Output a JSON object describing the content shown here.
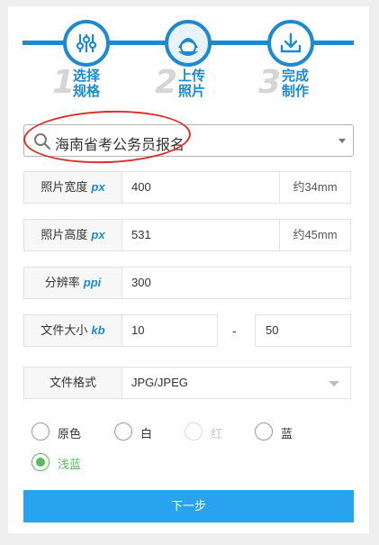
{
  "steps": [
    {
      "num": "1",
      "line1": "选择",
      "line2": "规格",
      "icon": "sliders-icon"
    },
    {
      "num": "2",
      "line1": "上传",
      "line2": "照片",
      "icon": "person-icon"
    },
    {
      "num": "3",
      "line1": "完成",
      "line2": "制作",
      "icon": "download-icon"
    }
  ],
  "search": {
    "value": "海南省考公务员报名",
    "icon": "search-icon"
  },
  "fields": {
    "width": {
      "label": "照片宽度",
      "unit": "px",
      "value": "400",
      "suffix": "约34mm"
    },
    "height": {
      "label": "照片高度",
      "unit": "px",
      "value": "531",
      "suffix": "约45mm"
    },
    "resolution": {
      "label": "分辨率",
      "unit": "ppi",
      "value": "300"
    },
    "filesize": {
      "label": "文件大小",
      "unit": "kb",
      "min": "10",
      "sep": "-",
      "max": "50"
    },
    "format": {
      "label": "文件格式",
      "value": "JPG/JPEG"
    }
  },
  "background_colors": [
    {
      "label": "原色",
      "state": "normal"
    },
    {
      "label": "白",
      "state": "normal"
    },
    {
      "label": "红",
      "state": "disabled"
    },
    {
      "label": "蓝",
      "state": "normal"
    },
    {
      "label": "浅蓝",
      "state": "selected"
    }
  ],
  "next_button": "下一步",
  "colors": {
    "accent": "#1c8ad1",
    "button": "#28a3ee",
    "selected": "#5cb85c",
    "annotation": "#d9302c"
  }
}
